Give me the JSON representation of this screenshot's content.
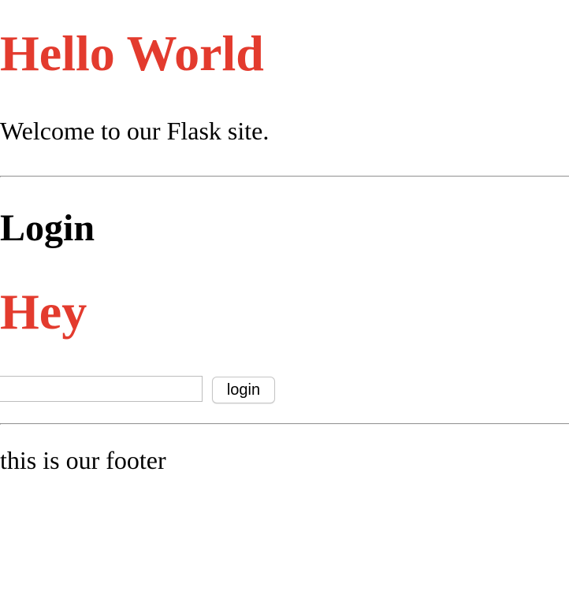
{
  "header": {
    "title": "Hello World",
    "welcome": "Welcome to our Flask site."
  },
  "login": {
    "heading": "Login",
    "greeting": "Hey",
    "username_value": "",
    "button_label": "login"
  },
  "footer": {
    "text": "this is our footer"
  },
  "colors": {
    "accent_red": "#e33b2e",
    "text": "#000000",
    "background": "#ffffff"
  }
}
